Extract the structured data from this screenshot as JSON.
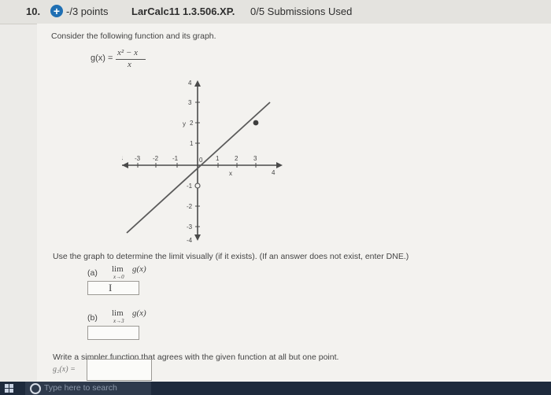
{
  "header": {
    "question_number": "10.",
    "points": "-/3 points",
    "assignment_code": "LarCalc11 1.3.506.XP.",
    "submissions": "0/5 Submissions Used"
  },
  "problem": {
    "intro": "Consider the following function and its graph.",
    "function_name": "g(x) =",
    "numerator": "x² − x",
    "denominator": "x",
    "instruction": "Use the graph to determine the limit visually (if it exists). (If an answer does not exist, enter DNE.)",
    "part_a": {
      "label": "(a)",
      "lim": "lim",
      "expr": "g(x)",
      "approach": "x→0",
      "answer": ""
    },
    "part_b": {
      "label": "(b)",
      "lim": "lim",
      "expr": "g(x)",
      "approach": "x→3",
      "answer": ""
    },
    "simpler_prompt": "Write a simpler function that agrees with the given function at all but one point.",
    "g2_label": "g₂(x) =",
    "g2_answer": ""
  },
  "graph": {
    "x_ticks": [
      "-4",
      "-3",
      "-2",
      "-1",
      "1",
      "2",
      "3",
      "4"
    ],
    "y_ticks": [
      "4",
      "3",
      "2",
      "1",
      "-1",
      "-2",
      "-3",
      "-4"
    ],
    "x_label": "x",
    "y_label": "y",
    "origin_label": "0",
    "line_color": "#555555",
    "closed_point": "(3, 2)",
    "open_point": "(0, -1)"
  },
  "taskbar": {
    "search_placeholder": "Type here to search"
  },
  "colors": {
    "accent": "#1f6fb3",
    "taskbar": "#1e2a3c"
  }
}
